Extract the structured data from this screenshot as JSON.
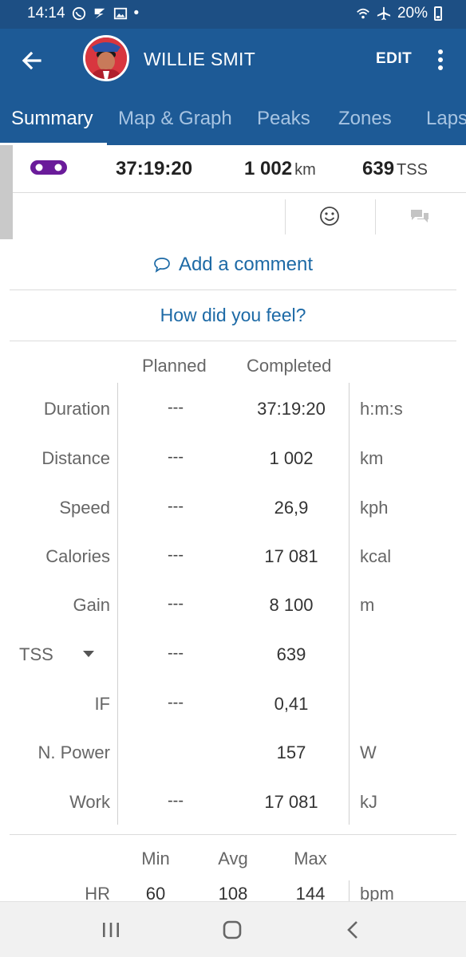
{
  "status_bar": {
    "time": "14:14",
    "battery": "20%"
  },
  "app_bar": {
    "title": "WILLIE SMIT",
    "edit_label": "EDIT"
  },
  "tabs": [
    {
      "label": "Summary",
      "active": true
    },
    {
      "label": "Map & Graph",
      "active": false
    },
    {
      "label": "Peaks",
      "active": false
    },
    {
      "label": "Zones",
      "active": false
    },
    {
      "label": "Laps",
      "active": false
    }
  ],
  "summary": {
    "duration": "37:19:20",
    "distance_value": "1 002",
    "distance_unit": "km",
    "tss_value": "639",
    "tss_unit": "TSS"
  },
  "actions": {
    "comment_label": "Add a comment",
    "feel_label": "How did you feel?"
  },
  "table": {
    "planned_header": "Planned",
    "completed_header": "Completed",
    "rows": [
      {
        "label": "Duration",
        "planned": "---",
        "completed": "37:19:20",
        "unit": "h:m:s"
      },
      {
        "label": "Distance",
        "planned": "---",
        "completed": "1 002",
        "unit": "km"
      },
      {
        "label": "Speed",
        "planned": "---",
        "completed": "26,9",
        "unit": "kph"
      },
      {
        "label": "Calories",
        "planned": "---",
        "completed": "17 081",
        "unit": "kcal"
      },
      {
        "label": "Gain",
        "planned": "---",
        "completed": "8 100",
        "unit": "m"
      },
      {
        "label": "TSS",
        "planned": "---",
        "completed": "639",
        "unit": ""
      },
      {
        "label": "IF",
        "planned": "---",
        "completed": "0,41",
        "unit": ""
      },
      {
        "label": "N. Power",
        "planned": "",
        "completed": "157",
        "unit": "W"
      },
      {
        "label": "Work",
        "planned": "---",
        "completed": "17 081",
        "unit": "kJ"
      }
    ]
  },
  "hr_table": {
    "headers": [
      "Min",
      "Avg",
      "Max"
    ],
    "label": "HR",
    "values": [
      "60",
      "108",
      "144"
    ],
    "unit": "bpm"
  },
  "colors": {
    "app_bar": "#1d5a96",
    "status_bar": "#1d4f84",
    "link": "#1d6aa6",
    "bike_icon": "#6a1b9a"
  },
  "icons": {
    "back": "arrow-left-icon",
    "more": "more-vert-icon",
    "bike": "bike-chain-icon",
    "smiley": "smiley-icon",
    "chat": "chat-bubble-icon",
    "comment": "comment-icon",
    "nav_recents": "recents-icon",
    "nav_home": "home-icon",
    "nav_back": "back-chevron-icon"
  }
}
